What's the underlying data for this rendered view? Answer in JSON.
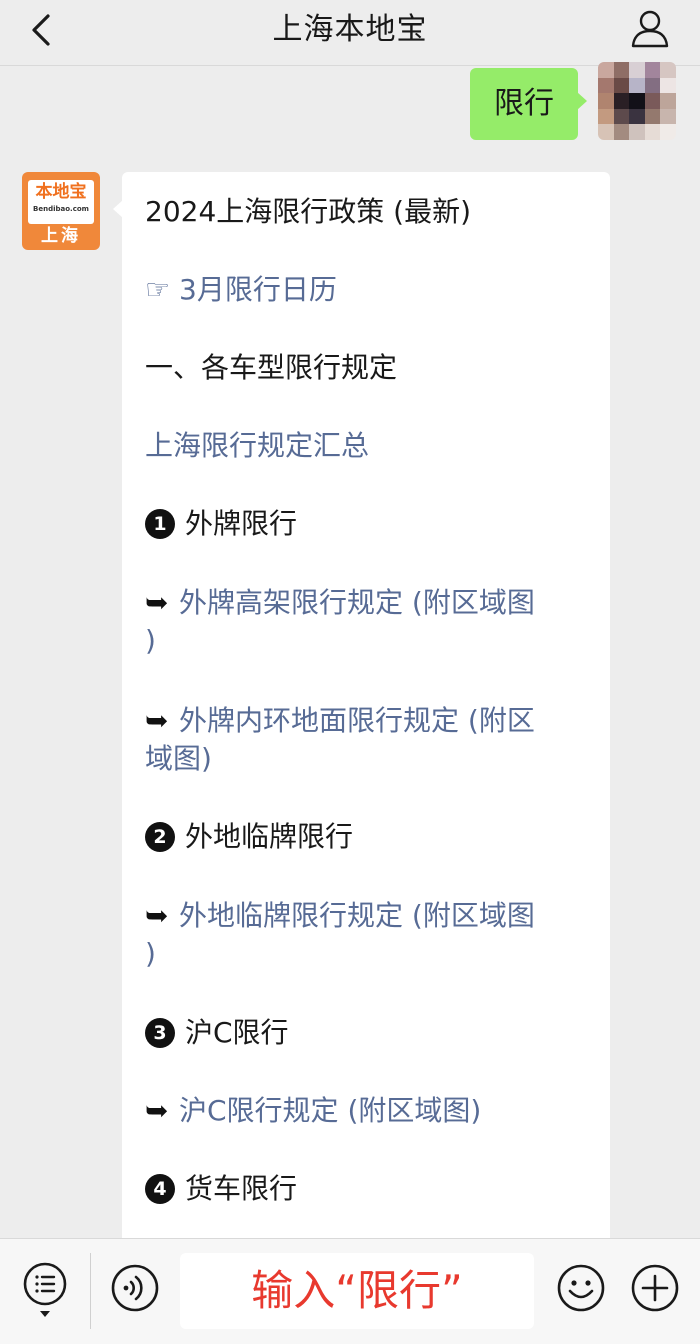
{
  "header": {
    "title": "上海本地宝",
    "back_icon": "chevron-left-icon",
    "profile_icon": "person-icon"
  },
  "outgoing": {
    "text": "限行"
  },
  "bot_avatar": {
    "brand": "本地宝",
    "domain": "Bendibao.com",
    "city": "上海"
  },
  "message": {
    "heading": "2024上海限行政策 (最新)",
    "calendar_link": {
      "marker": "☞",
      "text": "3月限行日历"
    },
    "section1_title": "一、各车型限行规定",
    "summary_link": "上海限行规定汇总",
    "groups": [
      {
        "number": "1",
        "title": "外牌限行",
        "links": [
          {
            "arrow": "➥",
            "line1": "外牌高架限行规定 (附区域图",
            "line2": ")"
          },
          {
            "arrow": "➥",
            "line1": "外牌内环地面限行规定 (附区",
            "line2": "域图)"
          }
        ]
      },
      {
        "number": "2",
        "title": "外地临牌限行",
        "links": [
          {
            "arrow": "➥",
            "line1": "外地临牌限行规定 (附区域图",
            "line2": ")"
          }
        ]
      },
      {
        "number": "3",
        "title": "沪C限行",
        "links": [
          {
            "arrow": "➥",
            "line1": "沪C限行规定 (附区域图)",
            "line2": ""
          }
        ]
      },
      {
        "number": "4",
        "title": "货车限行",
        "links": []
      }
    ]
  },
  "input_bar": {
    "input_value": "输入“限行”",
    "menu_icon": "menu-list-icon",
    "voice_icon": "voice-icon",
    "emoji_icon": "emoji-icon",
    "plus_icon": "plus-icon"
  },
  "colors": {
    "background": "#ededed",
    "outgoing_bubble": "#95ec69",
    "link": "#576b95",
    "input_text": "#e8392e",
    "brand_orange": "#f0883a"
  }
}
